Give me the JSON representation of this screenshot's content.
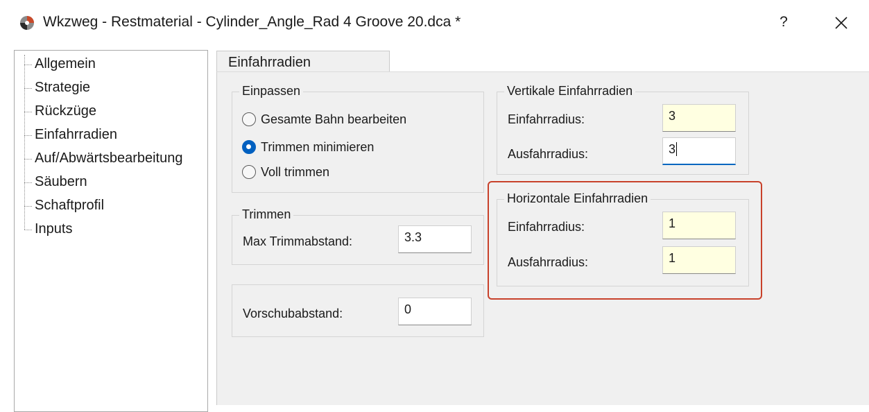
{
  "window": {
    "title": "Wkzweg - Restmaterial - Cylinder_Angle_Rad 4 Groove 20.dca *",
    "help_label": "?",
    "close_icon": "close-icon",
    "app_icon": "app-logo-icon"
  },
  "tree": {
    "items": [
      {
        "label": "Allgemein"
      },
      {
        "label": "Strategie"
      },
      {
        "label": "Rückzüge"
      },
      {
        "label": "Einfahrradien"
      },
      {
        "label": "Auf/Abwärtsbearbeitung"
      },
      {
        "label": "Säubern"
      },
      {
        "label": "Schaftprofil"
      },
      {
        "label": "Inputs"
      }
    ],
    "selected": "Einfahrradien"
  },
  "tab": {
    "label": "Einfahrradien"
  },
  "einpassen": {
    "title": "Einpassen",
    "options": [
      {
        "label": "Gesamte Bahn bearbeiten",
        "checked": false
      },
      {
        "label": "Trimmen minimieren",
        "checked": true
      },
      {
        "label": "Voll trimmen",
        "checked": false
      }
    ]
  },
  "trimmen": {
    "title": "Trimmen",
    "max_label": "Max Trimmabstand:",
    "max_value": "3.3"
  },
  "vorschub": {
    "label": "Vorschubabstand:",
    "value": "0"
  },
  "vertikal": {
    "title": "Vertikale Einfahrradien",
    "einfahr_label": "Einfahrradius:",
    "einfahr_value": "3",
    "ausfahr_label": "Ausfahrradius:",
    "ausfahr_value": "3"
  },
  "horizontal": {
    "title": "Horizontale Einfahrradien",
    "einfahr_label": "Einfahrradius:",
    "einfahr_value": "1",
    "ausfahr_label": "Ausfahrradius:",
    "ausfahr_value": "1"
  },
  "colors": {
    "highlight": "#c8412a",
    "accent": "#0060c0",
    "field_yellow": "#ffffe1",
    "panel_bg": "#f0f0f0"
  }
}
